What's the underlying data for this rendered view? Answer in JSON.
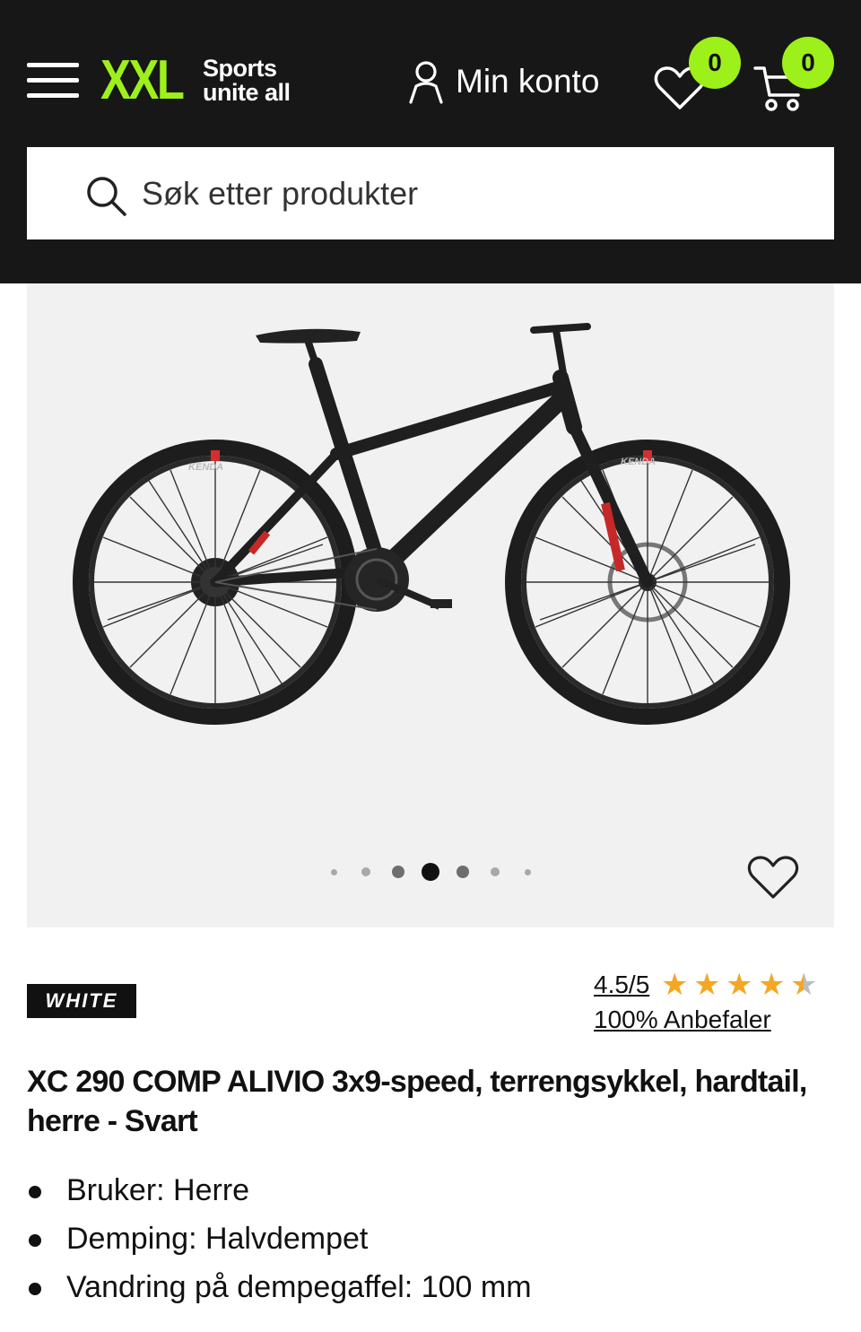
{
  "header": {
    "menu_icon": "hamburger-menu-icon",
    "logo": {
      "brand": "XXL",
      "tagline_line1": "Sports",
      "tagline_line2": "unite all"
    },
    "account_label": "Min konto",
    "account_icon": "user-icon",
    "wishlist": {
      "icon": "heart-icon",
      "count": "0"
    },
    "cart": {
      "icon": "cart-icon",
      "count": "0"
    },
    "colors": {
      "background": "#171717",
      "accent": "#9ef01a"
    }
  },
  "search": {
    "placeholder": "Søk etter produkter",
    "value": "",
    "icon": "search-icon"
  },
  "gallery": {
    "image": "mountain bike product photo",
    "dot_count": 7,
    "active_dot": 3,
    "favorite_icon": "heart-outline-icon",
    "background": "#f1f1f1"
  },
  "product": {
    "brand": "WHITE",
    "rating": "4.5/5",
    "rating_value": 4.5,
    "rating_max": 5,
    "recommend": "100% Anbefaler",
    "title": "XC 290 COMP ALIVIO 3x9-speed, terrengsykkel, hardtail, herre - Svart",
    "features": [
      "Bruker: Herre",
      "Demping: Halvdempet",
      "Vandring på dempegaffel: 100 mm"
    ]
  }
}
